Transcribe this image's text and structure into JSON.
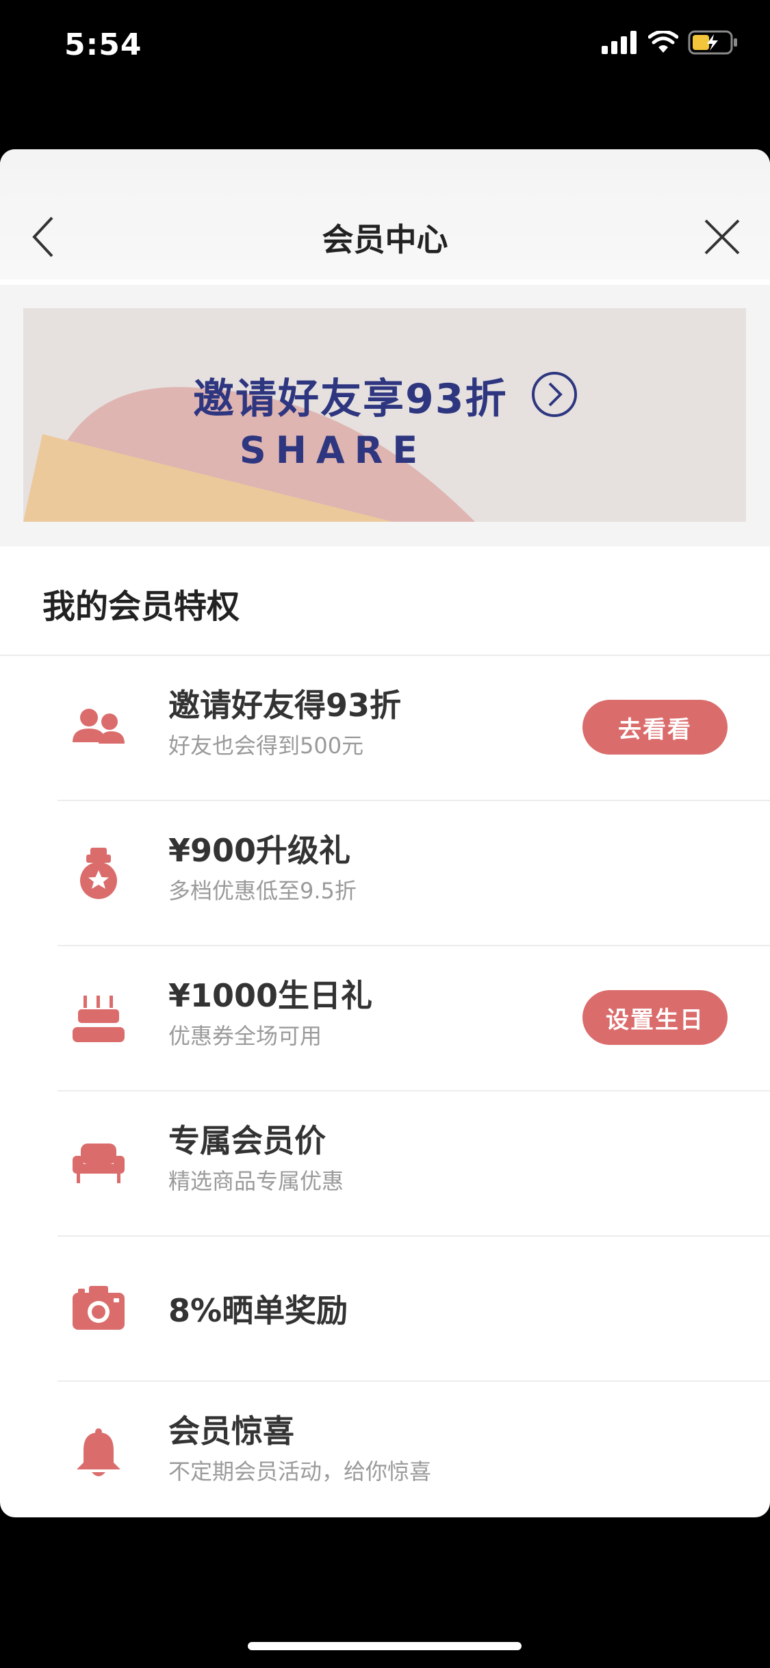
{
  "status": {
    "time": "5:54"
  },
  "nav": {
    "title": "会员中心"
  },
  "banner": {
    "title": "邀请好友享93折",
    "subtitle": "SHARE"
  },
  "section": {
    "title": "我的会员特权"
  },
  "perks": [
    {
      "icon": "users-icon",
      "title": "邀请好友得93折",
      "subtitle": "好友也会得到500元",
      "button": "去看看"
    },
    {
      "icon": "medal-icon",
      "title": "¥900升级礼",
      "subtitle": "多档优惠低至9.5折"
    },
    {
      "icon": "cake-icon",
      "title": "¥1000生日礼",
      "subtitle": "优惠券全场可用",
      "button": "设置生日"
    },
    {
      "icon": "sofa-icon",
      "title": "专属会员价",
      "subtitle": "精选商品专属优惠"
    },
    {
      "icon": "camera-icon",
      "title": "8%晒单奖励"
    },
    {
      "icon": "bell-icon",
      "title": "会员惊喜",
      "subtitle": "不定期会员活动，给你惊喜"
    }
  ],
  "colors": {
    "accent": "#db6c6c",
    "banner_text": "#2e3680",
    "banner_bg": "#e6e1df"
  }
}
